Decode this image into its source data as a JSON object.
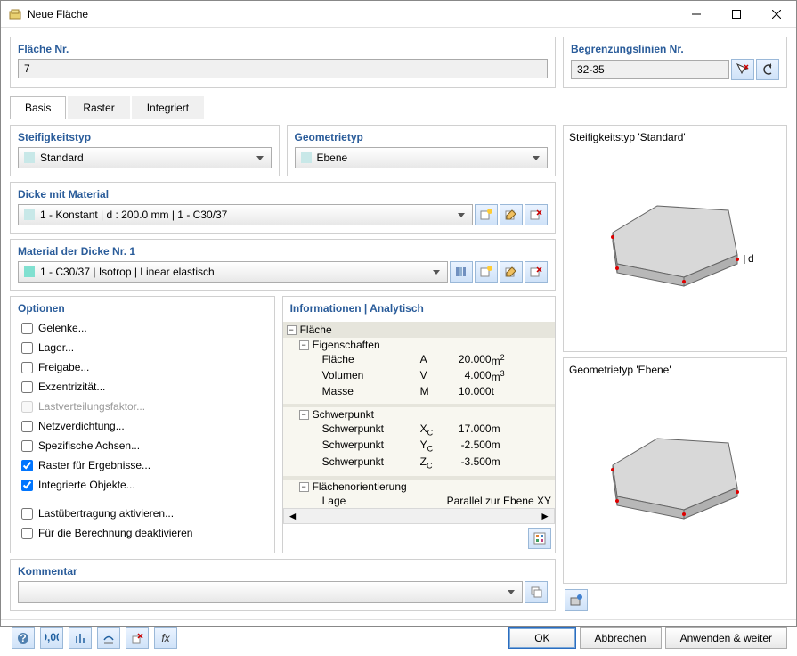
{
  "window": {
    "title": "Neue Fläche"
  },
  "header": {
    "surface_no_label": "Fläche Nr.",
    "surface_no_value": "7",
    "boundary_label": "Begrenzungslinien Nr.",
    "boundary_value": "32-35"
  },
  "tabs": {
    "basis": "Basis",
    "raster": "Raster",
    "integriert": "Integriert"
  },
  "stiffness": {
    "label": "Steifigkeitstyp",
    "value": "Standard"
  },
  "geometry": {
    "label": "Geometrietyp",
    "value": "Ebene"
  },
  "thickness": {
    "label": "Dicke mit Material",
    "value": "1 - Konstant | d : 200.0 mm | 1 - C30/37"
  },
  "material": {
    "label": "Material der Dicke Nr. 1",
    "value": "1 - C30/37 | Isotrop | Linear elastisch"
  },
  "options": {
    "label": "Optionen",
    "joints": "Gelenke...",
    "supports": "Lager...",
    "release": "Freigabe...",
    "ecc": "Exzentrizität...",
    "loaddist": "Lastverteilungsfaktor...",
    "mesh": "Netzverdichtung...",
    "axes": "Spezifische Achsen...",
    "grid": "Raster für Ergebnisse...",
    "integ": "Integrierte Objekte...",
    "transfer": "Lastübertragung aktivieren...",
    "deact": "Für die Berechnung deaktivieren"
  },
  "info": {
    "label": "Informationen | Analytisch",
    "surface": "Fläche",
    "props": "Eigenschaften",
    "area_lbl": "Fläche",
    "area_sym": "A",
    "area_val": "20.000",
    "area_unit": "m",
    "vol_lbl": "Volumen",
    "vol_sym": "V",
    "vol_val": "4.000",
    "vol_unit": "m",
    "mass_lbl": "Masse",
    "mass_sym": "M",
    "mass_val": "10.000",
    "mass_unit": "t",
    "centroid": "Schwerpunkt",
    "xc_lbl": "Schwerpunkt",
    "xc_sym": "X",
    "xc_val": "17.000",
    "xc_unit": "m",
    "yc_lbl": "Schwerpunkt",
    "yc_sym": "Y",
    "yc_val": "-2.500",
    "yc_unit": "m",
    "zc_lbl": "Schwerpunkt",
    "zc_sym": "Z",
    "zc_val": "-3.500",
    "zc_unit": "m",
    "orient": "Flächenorientierung",
    "pos_lbl": "Lage",
    "pos_val": "Parallel zur Ebene XY"
  },
  "comment": {
    "label": "Kommentar"
  },
  "preview": {
    "stiff": "Steifigkeitstyp 'Standard'",
    "geom": "Geometrietyp 'Ebene'"
  },
  "buttons": {
    "ok": "OK",
    "cancel": "Abbrechen",
    "apply": "Anwenden & weiter"
  },
  "chart_data": {
    "type": "table",
    "title": "Informationen | Analytisch",
    "groups": [
      {
        "name": "Eigenschaften",
        "rows": [
          {
            "label": "Fläche",
            "symbol": "A",
            "value": 20.0,
            "unit": "m²"
          },
          {
            "label": "Volumen",
            "symbol": "V",
            "value": 4.0,
            "unit": "m³"
          },
          {
            "label": "Masse",
            "symbol": "M",
            "value": 10.0,
            "unit": "t"
          }
        ]
      },
      {
        "name": "Schwerpunkt",
        "rows": [
          {
            "label": "Schwerpunkt",
            "symbol": "Xc",
            "value": 17.0,
            "unit": "m"
          },
          {
            "label": "Schwerpunkt",
            "symbol": "Yc",
            "value": -2.5,
            "unit": "m"
          },
          {
            "label": "Schwerpunkt",
            "symbol": "Zc",
            "value": -3.5,
            "unit": "m"
          }
        ]
      },
      {
        "name": "Flächenorientierung",
        "rows": [
          {
            "label": "Lage",
            "value": "Parallel zur Ebene XY"
          }
        ]
      }
    ]
  }
}
